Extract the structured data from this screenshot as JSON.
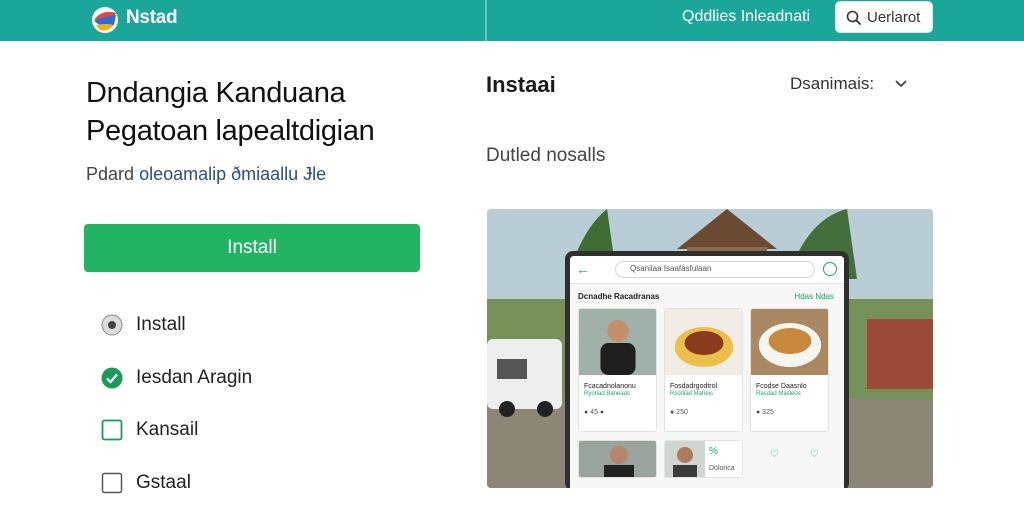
{
  "header": {
    "brand": "Nstad",
    "link_label": "Qddlies Inleadnati",
    "search_label": "Uerlarot",
    "icons": [
      "logo-icon",
      "search-icon"
    ],
    "colors": {
      "bar": "#1aa79a",
      "accent": "#22b463"
    }
  },
  "left": {
    "headline_line1": "Dndangia Kanduana",
    "headline_line2": "Pegatoan lapealtdigian",
    "subline_lead": "Pdard",
    "subline_link": "oleoamalip ðmiaallu Ɉle",
    "install_button": "Install",
    "options": [
      {
        "label": "Install",
        "state": "radio-filled"
      },
      {
        "label": "Iesdan Aragin",
        "state": "checked"
      },
      {
        "label": "Kansail",
        "state": "unchecked-green"
      },
      {
        "label": "Gstaal",
        "state": "unchecked"
      }
    ]
  },
  "right": {
    "title": "Instaai",
    "select_label": "Dsanimais:",
    "subtitle": "Dutled nosalls",
    "preview": {
      "search_text": "Qsanilaa Isaafasfulaan",
      "section_label": "Dcnadhe Racadranas",
      "see_all": "Hdas Ndas",
      "cards": [
        {
          "title": "Fcacadnolanonu",
          "subtitle": "Ryorlad Baneads",
          "meta": "● 45 ●"
        },
        {
          "title": "Fosdadrgodtrol",
          "subtitle": "Rsodiad Maheis",
          "meta": "● 250"
        },
        {
          "title": "Fcodse Daasnlo",
          "subtitle": "Rasdad Masleos",
          "meta": "● 325"
        }
      ],
      "bottom_label": "Dolonca"
    }
  }
}
